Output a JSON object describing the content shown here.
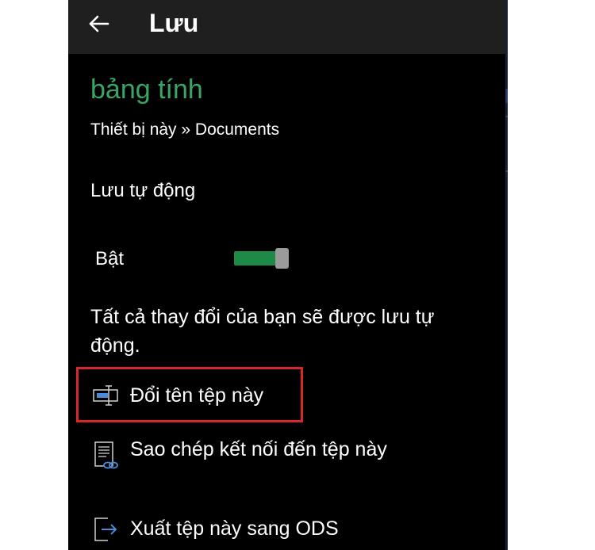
{
  "appbar": {
    "title": "Lưu",
    "back_icon": "arrow-left-icon"
  },
  "file": {
    "name": "bảng tính",
    "location": "Thiết bị này » Documents"
  },
  "autosave": {
    "title": "Lưu tự động",
    "toggle_label": "Bật",
    "toggle_on": true,
    "description": "Tất cả thay đổi của bạn sẽ được lưu tự động."
  },
  "menu": [
    {
      "label": "Đổi tên tệp này",
      "icon": "rename-icon",
      "highlighted": true
    },
    {
      "label": "Sao chép kết nối đến tệp này",
      "icon": "copy-link-icon"
    },
    {
      "label": "Xuất tệp này sang ODS",
      "icon": "export-icon"
    }
  ],
  "colors": {
    "accent_green": "#3aa566",
    "toggle_green": "#1d8a47",
    "highlight_red": "#d8262f",
    "icon_blue": "#4a8ad8"
  }
}
